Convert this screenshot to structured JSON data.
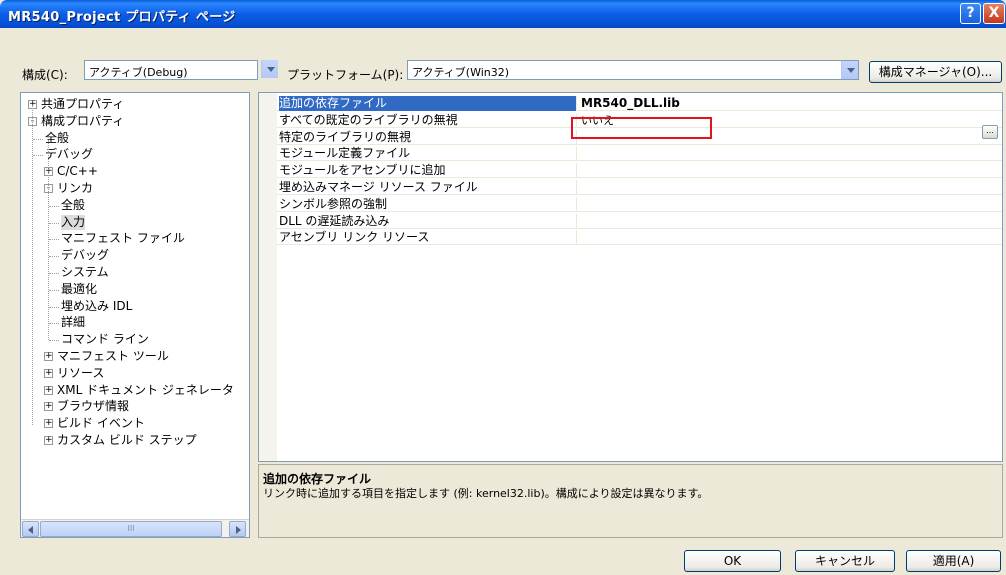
{
  "window": {
    "title": "MR540_Project プロパティ ページ",
    "help_glyph": "?",
    "close_glyph": "X"
  },
  "config_bar": {
    "configuration_label": "構成(C):",
    "configuration_value": "アクティブ(Debug)",
    "platform_label": "プラットフォーム(P):",
    "platform_value": "アクティブ(Win32)",
    "manager_button": "構成マネージャ(O)..."
  },
  "tree": {
    "items": [
      {
        "label": "共通プロパティ",
        "expander": "+"
      },
      {
        "label": "構成プロパティ",
        "expander": "-"
      },
      {
        "label": "全般"
      },
      {
        "label": "デバッグ"
      },
      {
        "label": "C/C++",
        "expander": "+"
      },
      {
        "label": "リンカ",
        "expander": "-"
      },
      {
        "label": "全般"
      },
      {
        "label": "入力",
        "selected": true
      },
      {
        "label": "マニフェスト ファイル"
      },
      {
        "label": "デバッグ"
      },
      {
        "label": "システム"
      },
      {
        "label": "最適化"
      },
      {
        "label": "埋め込み IDL"
      },
      {
        "label": "詳細"
      },
      {
        "label": "コマンド ライン"
      },
      {
        "label": "マニフェスト ツール",
        "expander": "+"
      },
      {
        "label": "リソース",
        "expander": "+"
      },
      {
        "label": "XML ドキュメント ジェネレータ",
        "expander": "+"
      },
      {
        "label": "ブラウザ情報",
        "expander": "+"
      },
      {
        "label": "ビルド イベント",
        "expander": "+"
      },
      {
        "label": "カスタム ビルド ステップ",
        "expander": "+"
      }
    ],
    "scrollbar_thumb_grip": "III"
  },
  "grid": {
    "rows": [
      {
        "name": "追加の依存ファイル",
        "value": "MR540_DLL.lib",
        "selected": true
      },
      {
        "name": "すべての既定のライブラリの無視",
        "value": "いいえ"
      },
      {
        "name": "特定のライブラリの無視",
        "value": ""
      },
      {
        "name": "モジュール定義ファイル",
        "value": ""
      },
      {
        "name": "モジュールをアセンブリに追加",
        "value": ""
      },
      {
        "name": "埋め込みマネージ リソース ファイル",
        "value": ""
      },
      {
        "name": "シンボル参照の強制",
        "value": ""
      },
      {
        "name": "DLL の遅延読み込み",
        "value": ""
      },
      {
        "name": "アセンブリ リンク リソース",
        "value": ""
      }
    ],
    "ellipsis_label": "..."
  },
  "description": {
    "title": "追加の依存ファイル",
    "text": "リンク時に追加する項目を指定します (例: kernel32.lib)。構成により設定は異なります。"
  },
  "buttons": {
    "ok": "OK",
    "cancel": "キャンセル",
    "apply": "適用(A)"
  }
}
